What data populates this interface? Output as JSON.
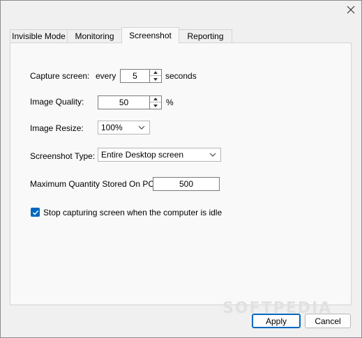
{
  "window": {
    "close_icon": "close-icon"
  },
  "tabs": [
    {
      "label": "Invisible Mode",
      "active": false
    },
    {
      "label": "Monitoring",
      "active": false
    },
    {
      "label": "Screenshot",
      "active": true
    },
    {
      "label": "Reporting",
      "active": false
    }
  ],
  "capture": {
    "label": "Capture screen:",
    "every_label": "every",
    "value": "5",
    "unit_label": "seconds"
  },
  "quality": {
    "label": "Image Quality:",
    "value": "50",
    "unit_label": "%"
  },
  "resize": {
    "label": "Image Resize:",
    "selected": "100%"
  },
  "screenshot_type": {
    "label": "Screenshot Type:",
    "selected": "Entire Desktop screen"
  },
  "max_quantity": {
    "label": "Maximum Quantity Stored On PC:",
    "value": "500"
  },
  "idle_option": {
    "label": "Stop capturing screen when the computer is idle",
    "checked": true
  },
  "buttons": {
    "apply_label": "Apply",
    "cancel_label": "Cancel"
  },
  "watermark": "SOFTPEDIA",
  "colors": {
    "accent": "#0067c0",
    "panel_bg": "#f9f9f9",
    "window_bg": "#f0f0f0"
  }
}
